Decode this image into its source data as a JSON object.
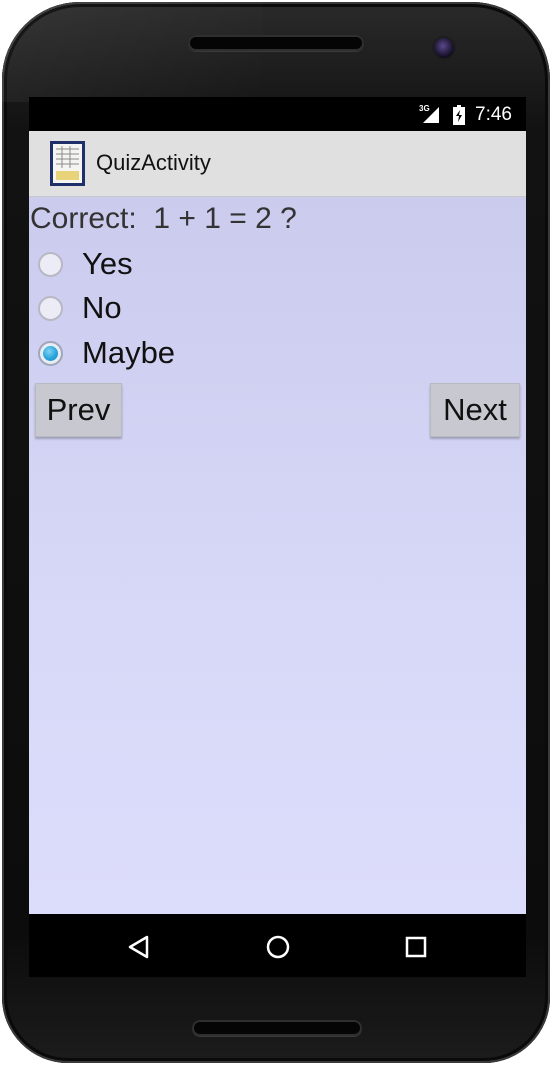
{
  "status_bar": {
    "network_type": "3G",
    "signal_icon": "signal-icon",
    "battery_icon": "battery-icon",
    "time": "7:46"
  },
  "action_bar": {
    "app_icon": "app-icon",
    "title": "QuizActivity"
  },
  "quiz": {
    "question": "Correct:  1 + 1 = 2 ?",
    "options": [
      {
        "label": "Yes",
        "selected": false
      },
      {
        "label": "No",
        "selected": false
      },
      {
        "label": "Maybe",
        "selected": true
      }
    ],
    "prev_label": "Prev",
    "next_label": "Next"
  },
  "navigation_bar": {
    "back_icon": "back-icon",
    "home_icon": "home-icon",
    "recent_apps_icon": "recent-apps-icon"
  },
  "colors": {
    "content_background": "#d8d8f8",
    "action_bar_background": "#e0e0e0",
    "button_background": "#c8c8d0",
    "radio_selected": "#2aa4dc"
  }
}
